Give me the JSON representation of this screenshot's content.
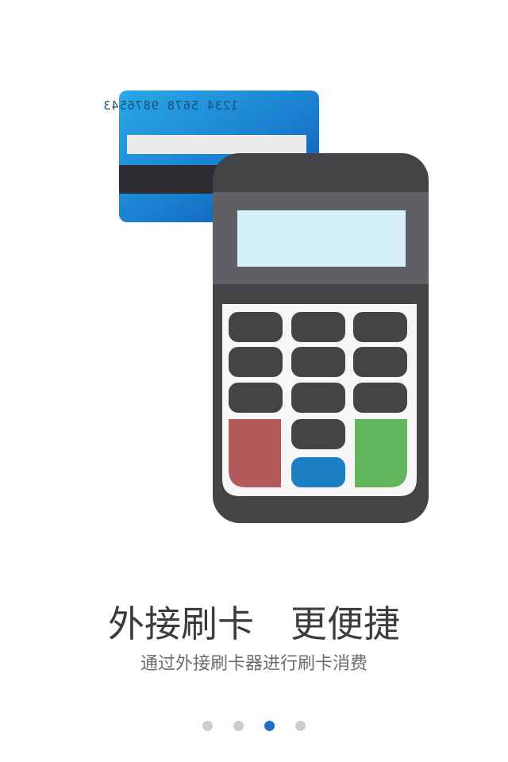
{
  "illustration": {
    "card_number": "1234 5678 9876543",
    "colors": {
      "card_blue": "#1f8fd8",
      "terminal_body": "#434446",
      "screen": "#d6effc",
      "cancel_key": "#b55a5a",
      "confirm_key": "#62b55b",
      "clear_key": "#1b7fc4"
    }
  },
  "content": {
    "headline": "外接刷卡　更便捷",
    "subtitle": "通过外接刷卡器进行刷卡消费"
  },
  "pager": {
    "total": 4,
    "active_index": 2
  }
}
